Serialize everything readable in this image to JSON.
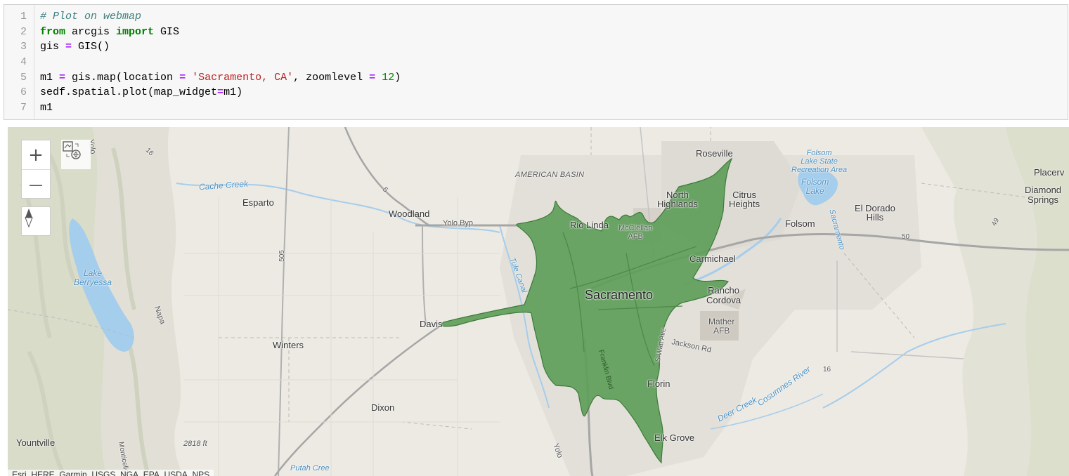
{
  "code_cell": {
    "line_numbers": [
      "1",
      "2",
      "3",
      "4",
      "5",
      "6",
      "7"
    ],
    "lines": [
      [
        {
          "t": "comment",
          "v": "# Plot on webmap"
        }
      ],
      [
        {
          "t": "kw",
          "v": "from"
        },
        {
          "t": "plain",
          "v": " arcgis "
        },
        {
          "t": "kw",
          "v": "import"
        },
        {
          "t": "plain",
          "v": " GIS"
        }
      ],
      [
        {
          "t": "plain",
          "v": "gis "
        },
        {
          "t": "op",
          "v": "="
        },
        {
          "t": "plain",
          "v": " GIS()"
        }
      ],
      [],
      [
        {
          "t": "plain",
          "v": "m1 "
        },
        {
          "t": "op",
          "v": "="
        },
        {
          "t": "plain",
          "v": " gis.map(location "
        },
        {
          "t": "op",
          "v": "="
        },
        {
          "t": "plain",
          "v": " "
        },
        {
          "t": "str",
          "v": "'Sacramento, CA'"
        },
        {
          "t": "plain",
          "v": ", zoomlevel "
        },
        {
          "t": "op",
          "v": "="
        },
        {
          "t": "plain",
          "v": " "
        },
        {
          "t": "num",
          "v": "12"
        },
        {
          "t": "plain",
          "v": ")"
        }
      ],
      [
        {
          "t": "plain",
          "v": "sedf.spatial.plot(map_widget"
        },
        {
          "t": "op",
          "v": "="
        },
        {
          "t": "plain",
          "v": "m1)"
        }
      ],
      [
        {
          "t": "plain",
          "v": "m1"
        }
      ]
    ]
  },
  "map": {
    "colors": {
      "base": "#eceae3",
      "water": "#a5cdec",
      "polygon_fill": "#5e9e5a",
      "polygon_stroke": "#3d7a3a",
      "urban": "#dcd9d2"
    },
    "controls": {
      "zoom_in": "+",
      "zoom_out": "—",
      "compass": "compass-icon",
      "basemap": "basemap-toggle-icon"
    },
    "labels": {
      "roseville": "Roseville",
      "folsom_lake_sra": "Folsom\nLake State\nRecreation Area",
      "folsom_lake": "Folsom\nLake",
      "placerville": "Placerv",
      "diamond_springs": "Diamond\nSprings",
      "american_basin": "AMERICAN BASIN",
      "cache_creek": "Cache Creek",
      "esparto": "Esparto",
      "woodland": "Woodland",
      "north_highlands": "North\nHighlands",
      "citrus_heights": "Citrus\nHeights",
      "el_dorado_hills": "El Dorado\nHills",
      "folsom": "Folsom",
      "yolo_byp": "Yolo Byp",
      "rio_linda": "Rio Linda",
      "mcclellan_afb": "McClellan\nAFB",
      "carmichael": "Carmichael",
      "lake_berryessa": "Lake\nBerryessa",
      "sacramento": "Sacramento",
      "rancho_cordova": "Rancho\nCordova",
      "davis": "Davis",
      "mather_afb": "Mather\nAFB",
      "winters": "Winters",
      "jackson_rd": "Jackson Rd",
      "florin": "Florin",
      "dixon": "Dixon",
      "yountville": "Yountville",
      "elevation": "2818 ft",
      "elk_grove": "Elk Grove",
      "deer_creek": "Deer Creek",
      "cosumnes_river": "Cosumnes River",
      "tule_canal": "Tule Canal",
      "napa": "Napa",
      "yolo": "Yolo",
      "sacramento_river": "Sacramento",
      "franklin_blvd": "Franklin Blvd",
      "s_watt_ave": "S Watt Ave",
      "putah_creek": "Putah Cree",
      "rte_5": "5",
      "rte_505": "505",
      "rte_50": "50",
      "rte_16": "16",
      "rte_16b": "16",
      "rte_49": "49",
      "monticello": "Monticello"
    },
    "attribution": "Esri, HERE, Garmin, USGS, NGA, EPA, USDA, NPS"
  }
}
